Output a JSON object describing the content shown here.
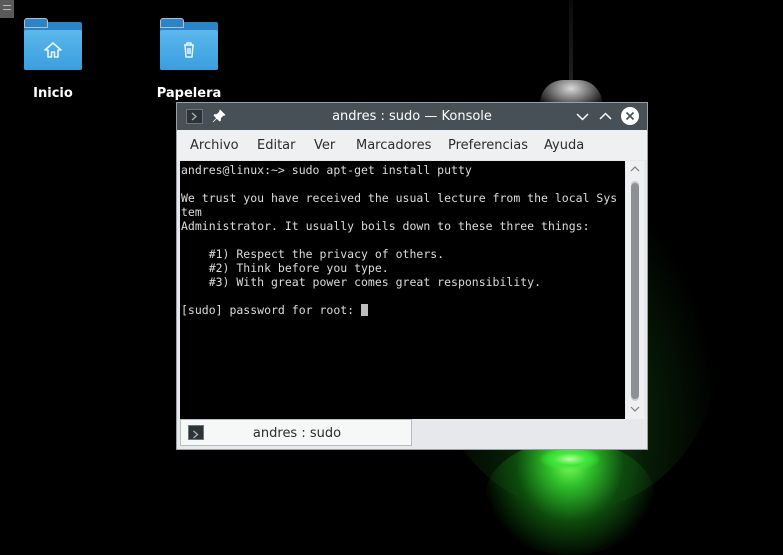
{
  "desktop": {
    "icons": [
      {
        "label": "Inicio",
        "glyph": "home-icon"
      },
      {
        "label": "Papelera",
        "glyph": "trash-icon"
      }
    ]
  },
  "window": {
    "title": "andres : sudo — Konsole",
    "menu": [
      "Archivo",
      "Editar",
      "Ver",
      "Marcadores",
      "Preferencias",
      "Ayuda"
    ],
    "terminal_lines": [
      "andres@linux:~> sudo apt-get install putty",
      "",
      "We trust you have received the usual lecture from the local Sys",
      "tem",
      "Administrator. It usually boils down to these three things:",
      "",
      "    #1) Respect the privacy of others.",
      "    #2) Think before you type.",
      "    #3) With great power comes great responsibility.",
      "",
      "[sudo] password for root: "
    ],
    "tab_label": "andres : sudo"
  },
  "colors": {
    "titlebar": "#475057",
    "folder": "#3a9ede",
    "terminal_bg": "#000000",
    "terminal_fg": "#dcdcdc",
    "glow": "#3ee63a"
  }
}
